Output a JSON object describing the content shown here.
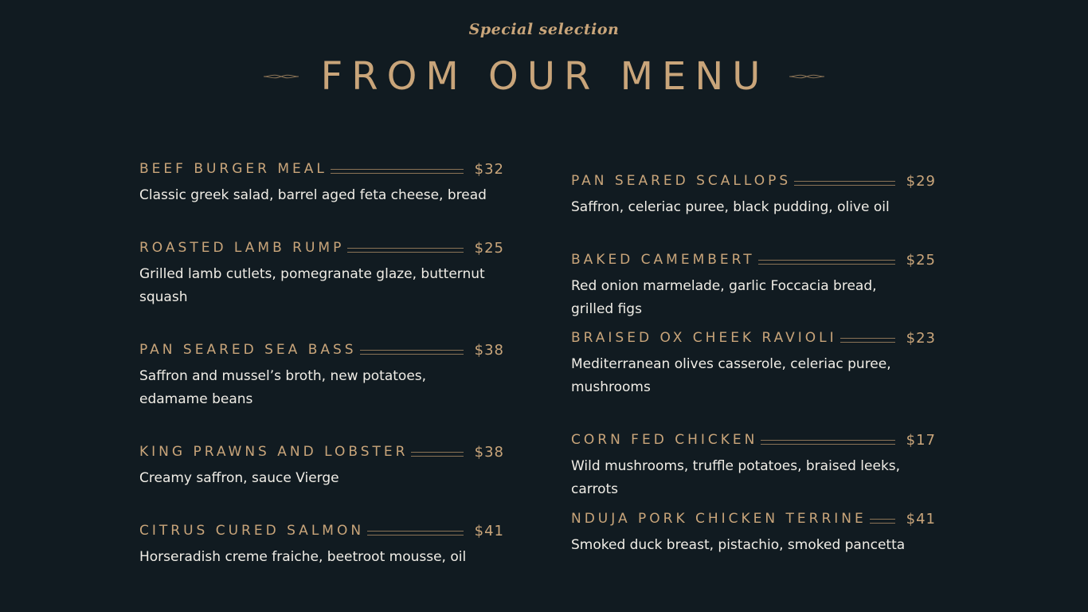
{
  "header": {
    "subtitle": "Special selection",
    "title": "FROM OUR MENU",
    "accent_color": "#c9a57a",
    "ornament_left_icon": "ornament-left-icon",
    "ornament_right_icon": "ornament-right-icon"
  },
  "menu": {
    "left": [
      {
        "name": "BEEF BURGER MEAL",
        "price": "$32",
        "description": "Classic greek salad, barrel aged feta cheese, bread"
      },
      {
        "name": "ROASTED LAMB RUMP",
        "price": "$25",
        "description": "Grilled lamb cutlets, pomegranate glaze, butternut squash"
      },
      {
        "name": "PAN SEARED SEA BASS",
        "price": "$38",
        "description": "Saffron and mussel’s broth, new potatoes, edamame beans"
      },
      {
        "name": "KING PRAWNS AND LOBSTER",
        "price": "$38",
        "description": "Creamy saffron, sauce Vierge"
      },
      {
        "name": "CITRUS CURED SALMON",
        "price": "$41",
        "description": "Horseradish creme fraiche, beetroot mousse, oil"
      }
    ],
    "right": [
      {
        "name": "PAN SEARED SCALLOPS",
        "price": "$29",
        "description": "Saffron, celeriac puree, black pudding, olive oil"
      },
      {
        "name": "BAKED CAMEMBERT",
        "price": "$25",
        "description": "Red onion marmelade, garlic Foccacia bread, grilled figs"
      },
      {
        "name": "BRAISED OX CHEEK RAVIOLI",
        "price": "$23",
        "description": "Mediterranean olives casserole, celeriac puree, mushrooms"
      },
      {
        "name": "CORN FED CHICKEN",
        "price": "$17",
        "description": "Wild mushrooms, truffle potatoes, braised leeks, carrots"
      },
      {
        "name": "NDUJA PORK CHICKEN TERRINE",
        "price": "$41",
        "description": "Smoked duck breast, pistachio, smoked pancetta"
      }
    ]
  }
}
